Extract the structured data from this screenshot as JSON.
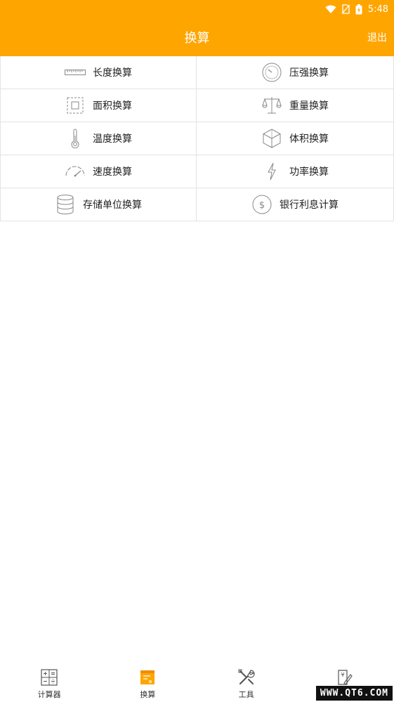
{
  "status": {
    "time": "5:48"
  },
  "header": {
    "title": "换算",
    "exit_label": "退出"
  },
  "items": [
    {
      "label": "长度换算",
      "icon": "ruler-icon"
    },
    {
      "label": "压强换算",
      "icon": "gauge-icon"
    },
    {
      "label": "面积换算",
      "icon": "area-icon"
    },
    {
      "label": "重量换算",
      "icon": "scale-icon"
    },
    {
      "label": "温度换算",
      "icon": "thermometer-icon"
    },
    {
      "label": "体积换算",
      "icon": "cube-icon"
    },
    {
      "label": "速度换算",
      "icon": "speedometer-icon"
    },
    {
      "label": "功率换算",
      "icon": "lightning-icon"
    },
    {
      "label": "存储单位换算",
      "icon": "database-icon"
    },
    {
      "label": "银行利息计算",
      "icon": "dollar-coin-icon"
    }
  ],
  "tabs": [
    {
      "label": "计算器",
      "icon": "calculator-icon"
    },
    {
      "label": "换算",
      "icon": "convert-icon",
      "active": true
    },
    {
      "label": "工具",
      "icon": "tools-icon"
    },
    {
      "label": "",
      "icon": "yen-note-icon"
    }
  ],
  "watermark": "WWW.QT6.COM",
  "colors": {
    "accent": "#FFA500",
    "divider": "#e3e3e3"
  }
}
